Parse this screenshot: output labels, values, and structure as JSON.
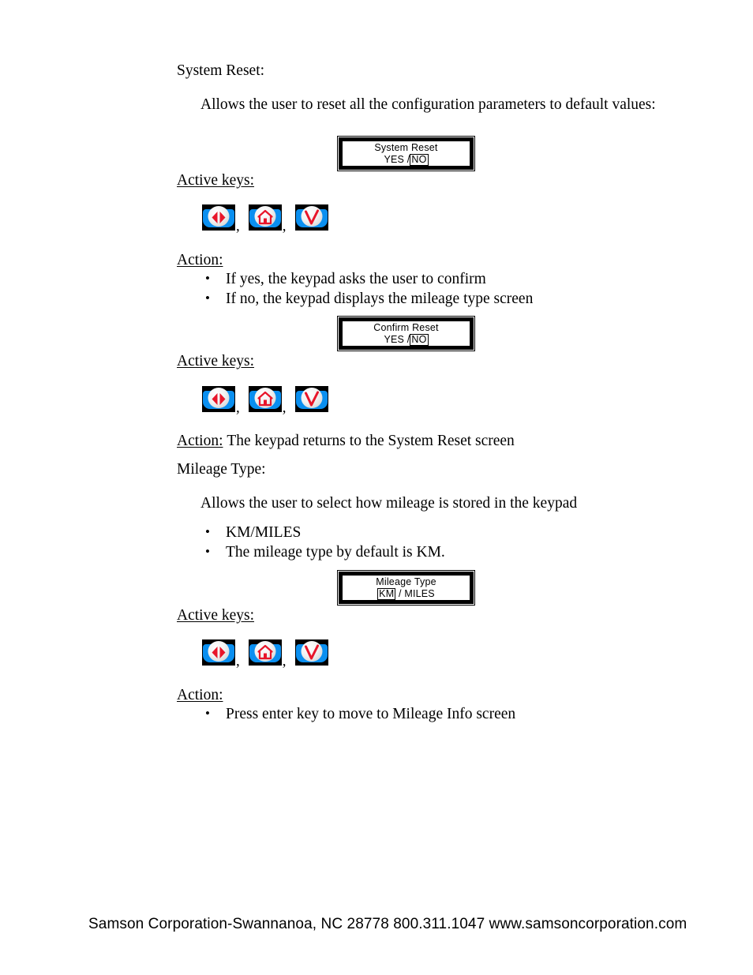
{
  "document": {
    "sections": {
      "system_reset_heading": "System Reset:",
      "system_reset_desc": "Allows the user to reset all the configuration parameters to default values:",
      "active_keys_label_1": "Active keys:",
      "action_label_1": "Action:",
      "action_bullets_1": [
        "If yes, the keypad asks the user to confirm",
        "If no, the keypad displays the mileage type screen"
      ],
      "active_keys_label_2": "Active keys:",
      "action_label_2": "Action:",
      "action_text_2": "The keypad returns to the System Reset screen",
      "mileage_type_heading": "Mileage Type:",
      "mileage_type_desc": "Allows the user to select how mileage is stored in the keypad",
      "mileage_bullets": [
        "KM/MILES",
        "The mileage type by default is KM."
      ],
      "active_keys_label_3": "Active keys:",
      "action_label_3": "Action:",
      "action_bullets_3": [
        "Press enter key to move to Mileage Info screen"
      ]
    },
    "lcd_screens": [
      {
        "name": "system-reset-screen",
        "line1": "System Reset",
        "line2_prefix": "YES /",
        "line2_highlight": "NO",
        "line2_suffix": ""
      },
      {
        "name": "confirm-reset-screen",
        "line1": "Confirm Reset",
        "line2_prefix": "YES /",
        "line2_highlight": "NO",
        "line2_suffix": ""
      },
      {
        "name": "mileage-type-screen",
        "line1": "Mileage Type",
        "line2_prefix": "",
        "line2_highlight": "KM",
        "line2_suffix": " /  MILES"
      }
    ],
    "key_icons": [
      {
        "name": "left-right-arrows-icon",
        "label": "left-right-arrows"
      },
      {
        "name": "home-icon",
        "label": "home"
      },
      {
        "name": "check-enter-icon",
        "label": "check"
      }
    ],
    "key_separator": ",",
    "footer": "Samson Corporation-Swannanoa, NC 28778  800.311.1047 www.samsoncorporation.com",
    "colors": {
      "icon_band": "#0a8ff0",
      "icon_glyph": "#e8152a",
      "text": "#000000",
      "page": "#ffffff"
    }
  }
}
